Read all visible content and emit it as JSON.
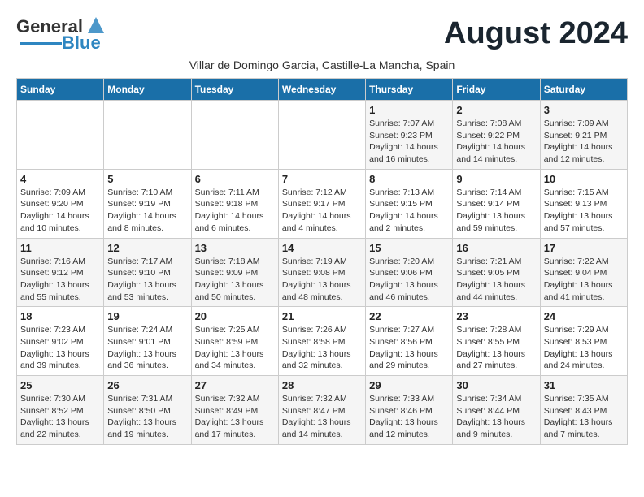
{
  "header": {
    "logo_line1": "General",
    "logo_line2": "Blue",
    "month_title": "August 2024",
    "subtitle": "Villar de Domingo Garcia, Castille-La Mancha, Spain"
  },
  "columns": [
    "Sunday",
    "Monday",
    "Tuesday",
    "Wednesday",
    "Thursday",
    "Friday",
    "Saturday"
  ],
  "weeks": [
    [
      {
        "num": "",
        "info": ""
      },
      {
        "num": "",
        "info": ""
      },
      {
        "num": "",
        "info": ""
      },
      {
        "num": "",
        "info": ""
      },
      {
        "num": "1",
        "info": "Sunrise: 7:07 AM\nSunset: 9:23 PM\nDaylight: 14 hours\nand 16 minutes."
      },
      {
        "num": "2",
        "info": "Sunrise: 7:08 AM\nSunset: 9:22 PM\nDaylight: 14 hours\nand 14 minutes."
      },
      {
        "num": "3",
        "info": "Sunrise: 7:09 AM\nSunset: 9:21 PM\nDaylight: 14 hours\nand 12 minutes."
      }
    ],
    [
      {
        "num": "4",
        "info": "Sunrise: 7:09 AM\nSunset: 9:20 PM\nDaylight: 14 hours\nand 10 minutes."
      },
      {
        "num": "5",
        "info": "Sunrise: 7:10 AM\nSunset: 9:19 PM\nDaylight: 14 hours\nand 8 minutes."
      },
      {
        "num": "6",
        "info": "Sunrise: 7:11 AM\nSunset: 9:18 PM\nDaylight: 14 hours\nand 6 minutes."
      },
      {
        "num": "7",
        "info": "Sunrise: 7:12 AM\nSunset: 9:17 PM\nDaylight: 14 hours\nand 4 minutes."
      },
      {
        "num": "8",
        "info": "Sunrise: 7:13 AM\nSunset: 9:15 PM\nDaylight: 14 hours\nand 2 minutes."
      },
      {
        "num": "9",
        "info": "Sunrise: 7:14 AM\nSunset: 9:14 PM\nDaylight: 13 hours\nand 59 minutes."
      },
      {
        "num": "10",
        "info": "Sunrise: 7:15 AM\nSunset: 9:13 PM\nDaylight: 13 hours\nand 57 minutes."
      }
    ],
    [
      {
        "num": "11",
        "info": "Sunrise: 7:16 AM\nSunset: 9:12 PM\nDaylight: 13 hours\nand 55 minutes."
      },
      {
        "num": "12",
        "info": "Sunrise: 7:17 AM\nSunset: 9:10 PM\nDaylight: 13 hours\nand 53 minutes."
      },
      {
        "num": "13",
        "info": "Sunrise: 7:18 AM\nSunset: 9:09 PM\nDaylight: 13 hours\nand 50 minutes."
      },
      {
        "num": "14",
        "info": "Sunrise: 7:19 AM\nSunset: 9:08 PM\nDaylight: 13 hours\nand 48 minutes."
      },
      {
        "num": "15",
        "info": "Sunrise: 7:20 AM\nSunset: 9:06 PM\nDaylight: 13 hours\nand 46 minutes."
      },
      {
        "num": "16",
        "info": "Sunrise: 7:21 AM\nSunset: 9:05 PM\nDaylight: 13 hours\nand 44 minutes."
      },
      {
        "num": "17",
        "info": "Sunrise: 7:22 AM\nSunset: 9:04 PM\nDaylight: 13 hours\nand 41 minutes."
      }
    ],
    [
      {
        "num": "18",
        "info": "Sunrise: 7:23 AM\nSunset: 9:02 PM\nDaylight: 13 hours\nand 39 minutes."
      },
      {
        "num": "19",
        "info": "Sunrise: 7:24 AM\nSunset: 9:01 PM\nDaylight: 13 hours\nand 36 minutes."
      },
      {
        "num": "20",
        "info": "Sunrise: 7:25 AM\nSunset: 8:59 PM\nDaylight: 13 hours\nand 34 minutes."
      },
      {
        "num": "21",
        "info": "Sunrise: 7:26 AM\nSunset: 8:58 PM\nDaylight: 13 hours\nand 32 minutes."
      },
      {
        "num": "22",
        "info": "Sunrise: 7:27 AM\nSunset: 8:56 PM\nDaylight: 13 hours\nand 29 minutes."
      },
      {
        "num": "23",
        "info": "Sunrise: 7:28 AM\nSunset: 8:55 PM\nDaylight: 13 hours\nand 27 minutes."
      },
      {
        "num": "24",
        "info": "Sunrise: 7:29 AM\nSunset: 8:53 PM\nDaylight: 13 hours\nand 24 minutes."
      }
    ],
    [
      {
        "num": "25",
        "info": "Sunrise: 7:30 AM\nSunset: 8:52 PM\nDaylight: 13 hours\nand 22 minutes."
      },
      {
        "num": "26",
        "info": "Sunrise: 7:31 AM\nSunset: 8:50 PM\nDaylight: 13 hours\nand 19 minutes."
      },
      {
        "num": "27",
        "info": "Sunrise: 7:32 AM\nSunset: 8:49 PM\nDaylight: 13 hours\nand 17 minutes."
      },
      {
        "num": "28",
        "info": "Sunrise: 7:32 AM\nSunset: 8:47 PM\nDaylight: 13 hours\nand 14 minutes."
      },
      {
        "num": "29",
        "info": "Sunrise: 7:33 AM\nSunset: 8:46 PM\nDaylight: 13 hours\nand 12 minutes."
      },
      {
        "num": "30",
        "info": "Sunrise: 7:34 AM\nSunset: 8:44 PM\nDaylight: 13 hours\nand 9 minutes."
      },
      {
        "num": "31",
        "info": "Sunrise: 7:35 AM\nSunset: 8:43 PM\nDaylight: 13 hours\nand 7 minutes."
      }
    ]
  ]
}
